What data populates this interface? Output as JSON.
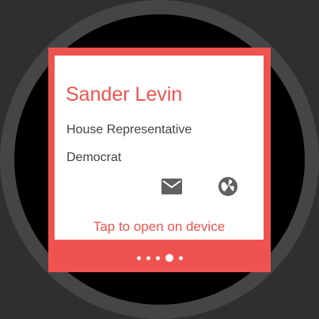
{
  "card": {
    "name": "Sander Levin",
    "title": "House Representative",
    "party": "Democrat",
    "action_text": "Tap to open on device",
    "actions": [
      {
        "icon": "mail-icon"
      },
      {
        "icon": "globe-icon"
      }
    ]
  },
  "pager": {
    "page_count": 5,
    "active_index": 3
  },
  "colors": {
    "accent": "#ef5350",
    "card_background": "#ffffff",
    "text_secondary": "#424242",
    "icon": "#616161",
    "watch_background": "#000000"
  }
}
